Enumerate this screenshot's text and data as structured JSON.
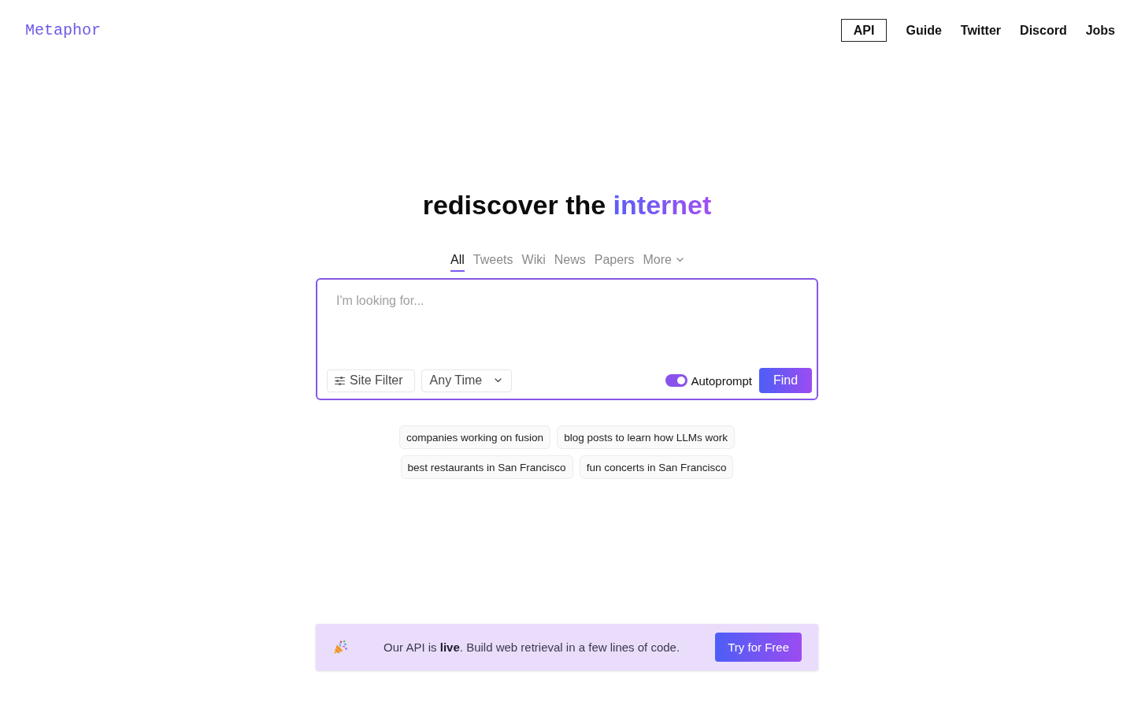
{
  "header": {
    "logo": "Metaphor",
    "nav": [
      {
        "label": "API",
        "kind": "outlined"
      },
      {
        "label": "Guide",
        "kind": "plain"
      },
      {
        "label": "Twitter",
        "kind": "plain"
      },
      {
        "label": "Discord",
        "kind": "plain"
      },
      {
        "label": "Jobs",
        "kind": "plain"
      }
    ]
  },
  "hero": {
    "title": [
      {
        "text": "rediscover the",
        "kind": "plain"
      },
      {
        "text": "internet",
        "kind": "gradient"
      }
    ]
  },
  "search": {
    "tabs": [
      {
        "label": "All",
        "selected": true,
        "kind": "tab"
      },
      {
        "label": "Tweets",
        "selected": false,
        "kind": "tab"
      },
      {
        "label": "Wiki",
        "selected": false,
        "kind": "tab"
      },
      {
        "label": "News",
        "selected": false,
        "kind": "tab"
      },
      {
        "label": "Papers",
        "selected": false,
        "kind": "tab"
      },
      {
        "label": "More",
        "selected": false,
        "kind": "dropdown"
      }
    ],
    "placeholder": "I'm looking for...",
    "site_filter": {
      "label": "Site Filter"
    },
    "time_range": {
      "value": "Any Time"
    },
    "autoprompt": {
      "label": "Autoprompt",
      "on": true
    },
    "find_button": "Find"
  },
  "suggestions": [
    "companies working on fusion",
    "blog posts to learn how LLMs work",
    "best restaurants in San Francisco",
    "fun concerts in San Francisco"
  ],
  "banner": {
    "text": "Our API is **live**. Build web retrieval in a few lines of code.",
    "button": "Try for Free"
  }
}
